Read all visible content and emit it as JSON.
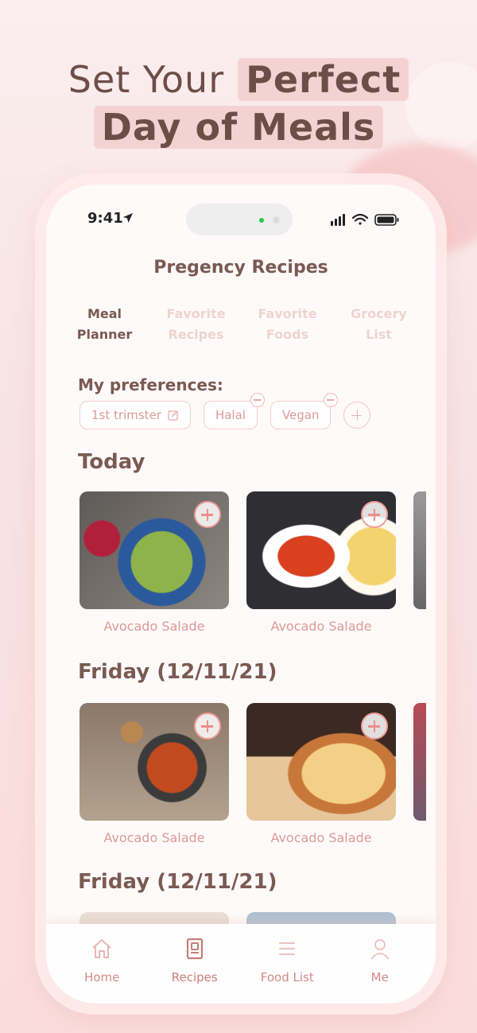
{
  "headline": {
    "line1_light": "Set Your",
    "line1_bold": "Perfect",
    "line2_bold": "Day of Meals"
  },
  "status_bar": {
    "time": "9:41"
  },
  "app": {
    "title": "Pregency Recipes"
  },
  "tabs": [
    {
      "line1": "Meal",
      "line2": "Planner",
      "active": true
    },
    {
      "line1": "Favorite",
      "line2": "Recipes",
      "active": false
    },
    {
      "line1": "Favorite",
      "line2": "Foods",
      "active": false
    },
    {
      "line1": "Grocery",
      "line2": "List",
      "active": false
    }
  ],
  "preferences": {
    "title": "My preferences:",
    "chips": [
      "1st trimster",
      "Halal",
      "Vegan"
    ]
  },
  "sections": [
    {
      "title": "Today",
      "cards": [
        {
          "label": "Avocado Salade",
          "image": "salad-bowl"
        },
        {
          "label": "Avocado Salade",
          "image": "baked-tomatoes-feta"
        }
      ]
    },
    {
      "title": "Friday (12/11/21)",
      "cards": [
        {
          "label": "Avocado Salade",
          "image": "bean-stew"
        },
        {
          "label": "Avocado Salade",
          "image": "cheese-toast"
        }
      ]
    },
    {
      "title": "Friday (12/11/21)",
      "cards": []
    }
  ],
  "bottom_nav": [
    {
      "label": "Home",
      "icon": "home-icon"
    },
    {
      "label": "Recipes",
      "icon": "recipe-book-icon"
    },
    {
      "label": "Food List",
      "icon": "list-icon"
    },
    {
      "label": "Me",
      "icon": "user-icon"
    }
  ],
  "colors": {
    "brand_brown": "#7a5a52",
    "accent_pink": "#dc9a96",
    "inactive_tab": "#eed3cf",
    "background": "#fbeeee"
  }
}
